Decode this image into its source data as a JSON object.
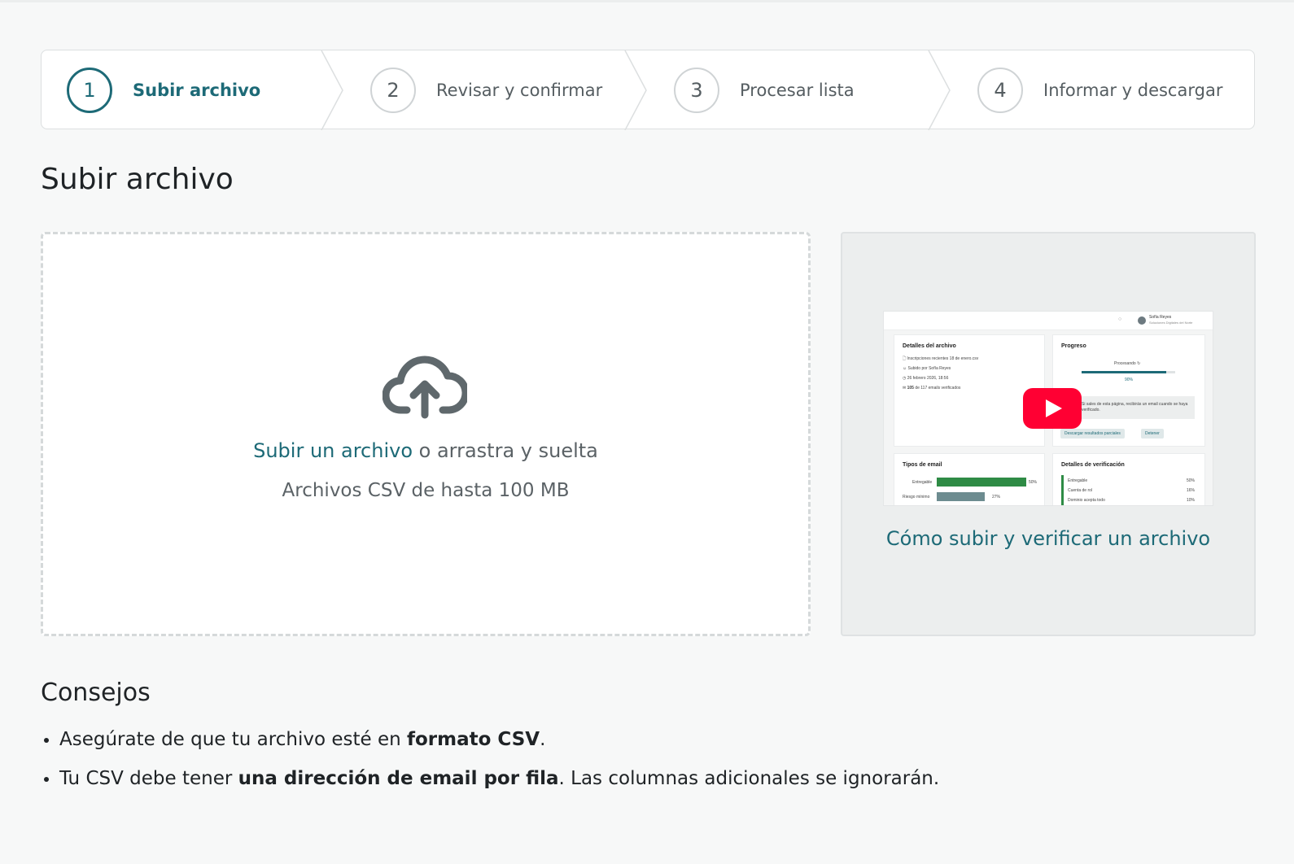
{
  "stepper": {
    "steps": [
      {
        "number": "1",
        "label": "Subir archivo",
        "active": true
      },
      {
        "number": "2",
        "label": "Revisar y confirmar",
        "active": false
      },
      {
        "number": "3",
        "label": "Procesar lista",
        "active": false
      },
      {
        "number": "4",
        "label": "Informar y descargar",
        "active": false
      }
    ]
  },
  "page": {
    "title": "Subir archivo"
  },
  "dropzone": {
    "icon": "cloud-upload-icon",
    "link_text": "Subir un archivo",
    "drag_text": " o arrastra y suelta",
    "size_text": "Archivos CSV de hasta 100 MB"
  },
  "video": {
    "title": "Cómo subir y verificar un archivo",
    "thumbnail": {
      "user_name": "Sofía Reyes",
      "org_name": "Soluciones Digitales del Norte",
      "details_title": "Detalles del archivo",
      "file_name": "Inscripciones recientes 18 de enero.csv",
      "uploaded_by": "Subido por Sofía Reyes",
      "date": "26 febrero 2026, 18:56",
      "verified_count": "105",
      "verified_text": " de 117 emails verificados",
      "progress_title": "Progreso",
      "processing_label": "Procesando",
      "progress_pct": "90%",
      "progress_value": 0.9,
      "notice": "Si sales de esta página, recibirás un email cuando se haya verificado.",
      "download_partial": "Descargar resultados parciales",
      "stop": "Detener",
      "email_types_title": "Tipos de email",
      "email_types": [
        {
          "label": "Entregable",
          "pct": "50%",
          "value": 50,
          "color": "#2e8b45"
        },
        {
          "label": "Riesgo mínimo",
          "pct": "27%",
          "value": 27,
          "color": "#6d8c90"
        }
      ],
      "verification_title": "Detalles de verificación",
      "verification_items": [
        {
          "label": "Entregable",
          "pct": "50%"
        },
        {
          "label": "Cuenta de rol",
          "pct": "16%"
        },
        {
          "label": "Dominio acepta todo",
          "pct": "10%"
        }
      ]
    }
  },
  "tips": {
    "title": "Consejos",
    "items": [
      {
        "before": "Asegúrate de que tu archivo esté en ",
        "bold": "formato CSV",
        "after": "."
      },
      {
        "before": "Tu CSV debe tener ",
        "bold": "una dirección de email por fila",
        "after": ". Las columnas adicionales se ignorarán."
      }
    ]
  },
  "colors": {
    "accent": "#1d6a77",
    "muted_text": "#5b6266",
    "play_red": "#ff0033"
  }
}
